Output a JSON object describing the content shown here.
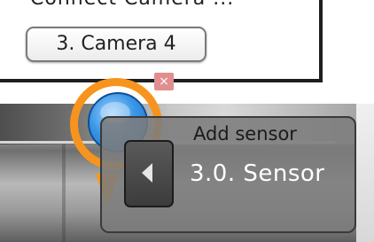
{
  "top_partial_text": "Connect Camera ...",
  "camera_chip": {
    "label": "3. Camera 4"
  },
  "close_icon": {
    "glyph": "×",
    "color": "#e08e90"
  },
  "marker": {
    "ring_color": "#f7941d",
    "ball_color": "#3b97e6",
    "icon": "sensor-marker-icon"
  },
  "popup": {
    "title": "Add sensor",
    "sensor_label": "3.0. Sensor",
    "nav_icon": "left-arrow-icon"
  }
}
